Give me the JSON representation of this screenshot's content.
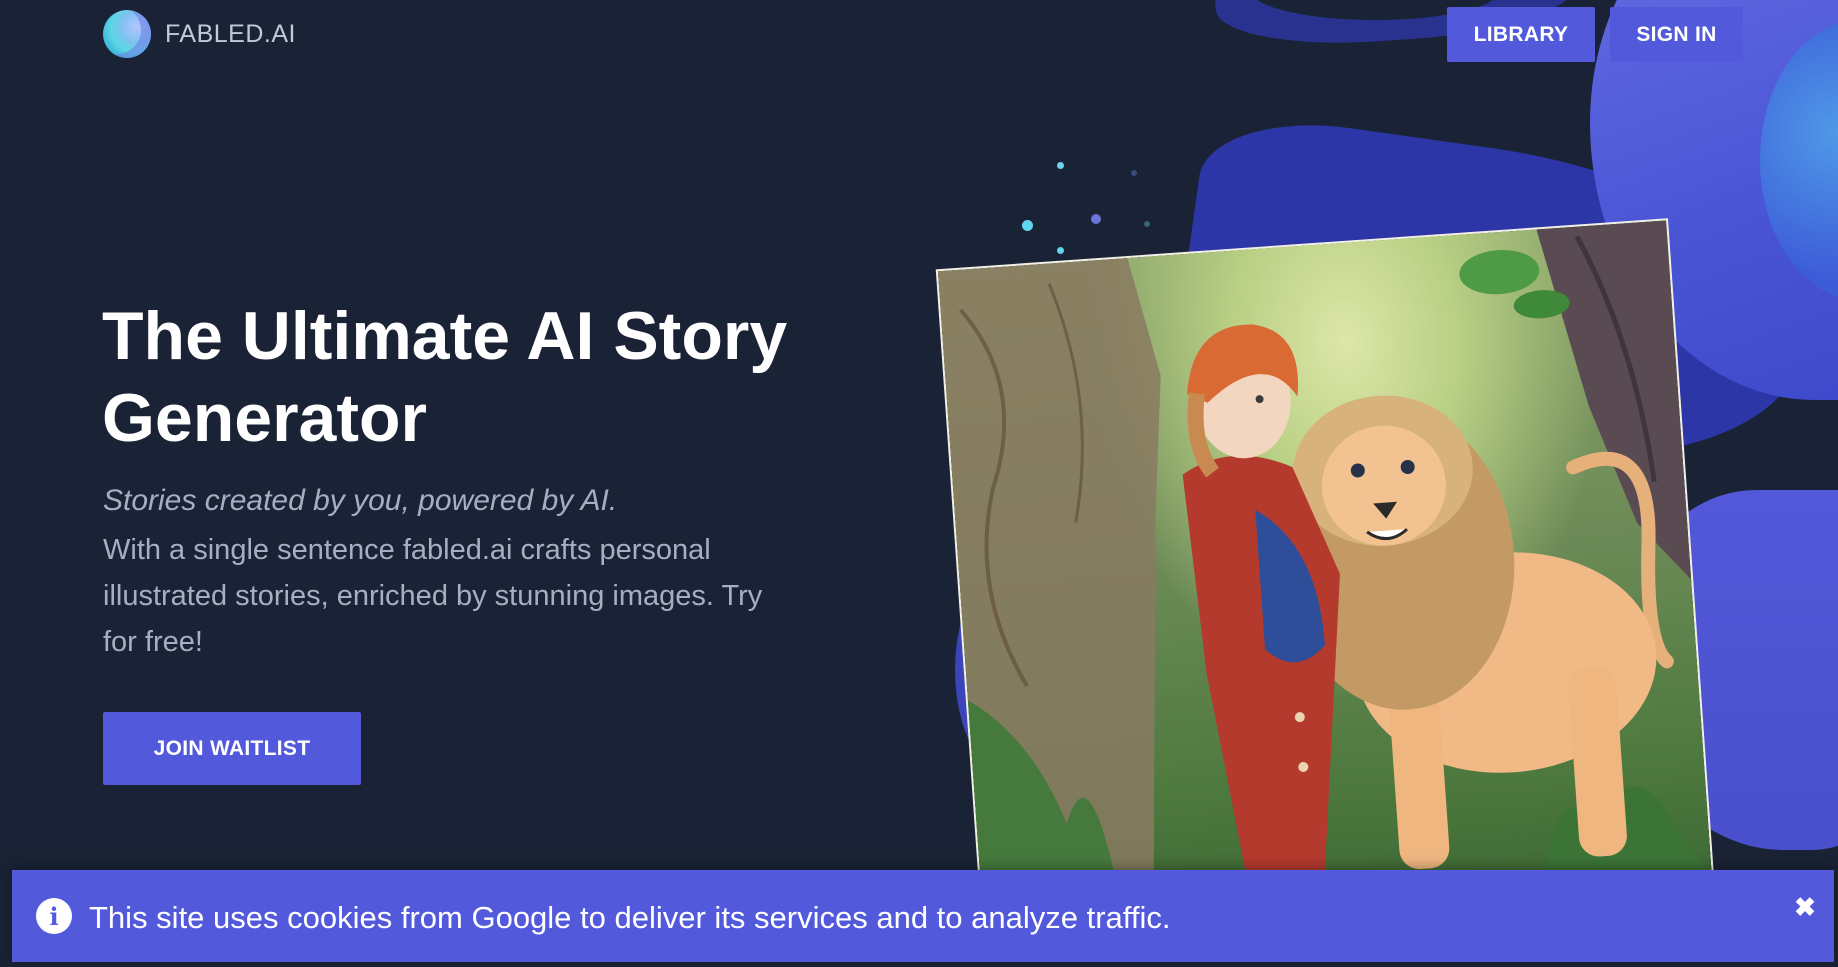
{
  "brand": {
    "name": "FABLED.AI"
  },
  "nav": {
    "library_label": "LIBRARY",
    "signin_label": "SIGN IN"
  },
  "hero": {
    "title": "The Ultimate AI Story Generator",
    "tagline": "Stories created by you, powered by AI.",
    "description": "With a single sentence fabled.ai crafts personal illustrated stories, enriched by stunning images. Try for free!",
    "cta_label": "JOIN WAITLIST"
  },
  "illustration": {
    "subject": "watercolor illustration of a child in a red coat standing next to a lion in a forest"
  },
  "cookie_banner": {
    "text": "This site uses cookies from Google to deliver its services and to analyze traffic.",
    "info_icon": "info-icon",
    "close_icon": "close-icon"
  },
  "colors": {
    "background": "#1a2235",
    "accent": "#5359db",
    "muted_text": "#a8aec2"
  }
}
